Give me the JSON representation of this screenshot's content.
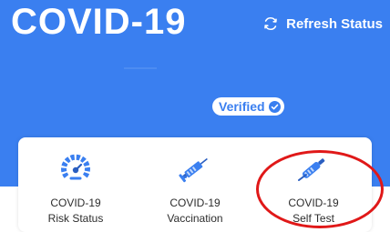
{
  "header": {
    "title": "COVID-19",
    "refresh_label": "Refresh Status",
    "refresh_icon": "refresh-icon",
    "verified_label": "Verified",
    "verified_icon": "check-circle-icon"
  },
  "tiles": [
    {
      "line1": "COVID-19",
      "line2": "Risk Status",
      "icon": "gauge-icon"
    },
    {
      "line1": "COVID-19",
      "line2": "Vaccination",
      "icon": "syringe-icon"
    },
    {
      "line1": "COVID-19",
      "line2": "Self Test",
      "icon": "test-swab-icon"
    }
  ],
  "colors": {
    "header_blue": "#3a7ff0",
    "highlight_red": "#e01818"
  }
}
